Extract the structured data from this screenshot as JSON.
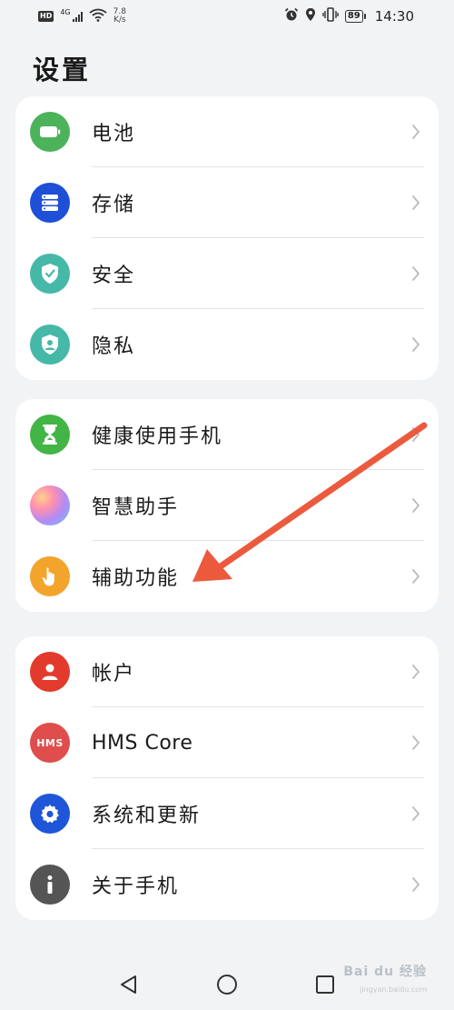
{
  "status_bar": {
    "hd": "HD",
    "net_type": "4G",
    "speed_value": "7.8",
    "speed_unit": "K/s",
    "battery": "89",
    "time": "14:30"
  },
  "page": {
    "title": "设置"
  },
  "groups": [
    {
      "items": [
        {
          "label": "电池",
          "icon": "battery-icon",
          "color": "#4cb35a"
        },
        {
          "label": "存储",
          "icon": "storage-icon",
          "color": "#1f4fd6"
        },
        {
          "label": "安全",
          "icon": "shield-check-icon",
          "color": "#46b8a8"
        },
        {
          "label": "隐私",
          "icon": "privacy-shield-icon",
          "color": "#46b8a8"
        }
      ]
    },
    {
      "items": [
        {
          "label": "健康使用手机",
          "icon": "hourglass-icon",
          "color": "#43b446"
        },
        {
          "label": "智慧助手",
          "icon": "smart-assistant-icon",
          "color": "#a98cf0"
        },
        {
          "label": "辅助功能",
          "icon": "hand-tap-icon",
          "color": "#f3a42a"
        }
      ]
    },
    {
      "items": [
        {
          "label": "帐户",
          "icon": "user-icon",
          "color": "#e23a2c"
        },
        {
          "label": "HMS Core",
          "icon": "hms-logo-icon",
          "color": "#e04d4d",
          "badge": "HMS"
        },
        {
          "label": "系统和更新",
          "icon": "gear-icon",
          "color": "#1f55d8"
        },
        {
          "label": "关于手机",
          "icon": "info-icon",
          "color": "#555555"
        }
      ]
    }
  ],
  "annotation": {
    "arrow_color": "#ec5a3e"
  },
  "watermark": {
    "text": "Bai du 经验",
    "sub": "jingyan.baidu.com"
  }
}
